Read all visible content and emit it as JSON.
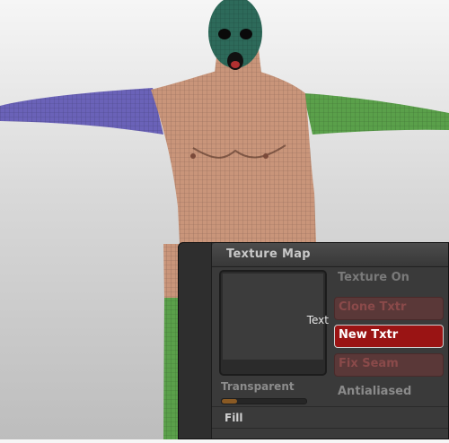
{
  "viewport": {
    "background": "#d6d6d6",
    "model_colors": {
      "head": "#2d6a5a",
      "torso": "#c9957a",
      "left_arm": "#6a62b8",
      "right_arm": "#5aa04a",
      "leg": "#5aa04a"
    }
  },
  "panel": {
    "title": "Texture Map",
    "preview_label": "Text",
    "transparent_label": "Transparent",
    "transparent_value": 0.18,
    "buttons": {
      "texture_on": "Texture On",
      "clone_txtr": "Clone Txtr",
      "new_txtr": "New Txtr",
      "fix_seam": "Fix Seam",
      "antialiased": "Antialiased"
    },
    "fill_label": "Fill",
    "colors": {
      "accent": "#9a1414",
      "disabled_button": "#5a3838"
    }
  }
}
